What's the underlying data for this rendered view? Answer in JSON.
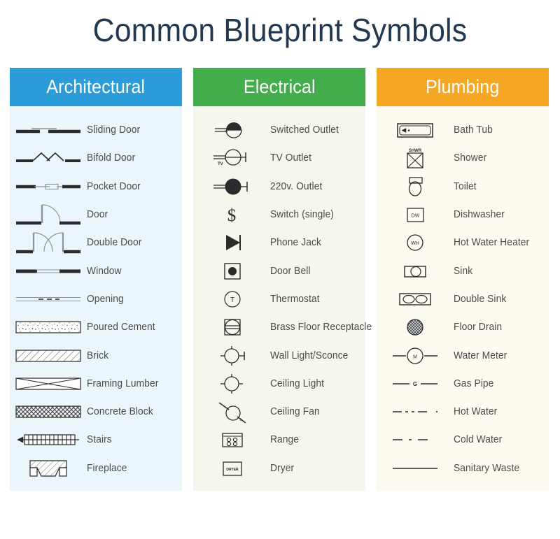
{
  "title": "Common Blueprint Symbols",
  "colors": {
    "architectural": "#2b9cd8",
    "electrical": "#43ad4c",
    "plumbing": "#f5a623",
    "title_text": "#22384f",
    "label_text": "#4a4a4a",
    "symbol_ink": "#2b2b2b"
  },
  "columns": [
    {
      "id": "architectural",
      "header": "Architectural",
      "items": [
        {
          "symbol": "sliding-door-symbol",
          "label": "Sliding Door"
        },
        {
          "symbol": "bifold-door-symbol",
          "label": "Bifold Door"
        },
        {
          "symbol": "pocket-door-symbol",
          "label": "Pocket Door"
        },
        {
          "symbol": "door-symbol",
          "label": "Door"
        },
        {
          "symbol": "double-door-symbol",
          "label": "Double Door"
        },
        {
          "symbol": "window-symbol",
          "label": "Window"
        },
        {
          "symbol": "opening-symbol",
          "label": "Opening"
        },
        {
          "symbol": "poured-cement-symbol",
          "label": "Poured Cement"
        },
        {
          "symbol": "brick-symbol",
          "label": "Brick"
        },
        {
          "symbol": "framing-lumber-symbol",
          "label": "Framing Lumber"
        },
        {
          "symbol": "concrete-block-symbol",
          "label": "Concrete Block"
        },
        {
          "symbol": "stairs-symbol",
          "label": "Stairs"
        },
        {
          "symbol": "fireplace-symbol",
          "label": "Fireplace"
        }
      ]
    },
    {
      "id": "electrical",
      "header": "Electrical",
      "items": [
        {
          "symbol": "switched-outlet-symbol",
          "label": "Switched Outlet"
        },
        {
          "symbol": "tv-outlet-symbol",
          "label": "TV Outlet",
          "glyph": "TV"
        },
        {
          "symbol": "220v-outlet-symbol",
          "label": "220v. Outlet"
        },
        {
          "symbol": "switch-single-symbol",
          "label": "Switch (single)",
          "glyph": "$"
        },
        {
          "symbol": "phone-jack-symbol",
          "label": "Phone Jack"
        },
        {
          "symbol": "door-bell-symbol",
          "label": "Door Bell"
        },
        {
          "symbol": "thermostat-symbol",
          "label": "Thermostat",
          "glyph": "T"
        },
        {
          "symbol": "brass-floor-receptacle-symbol",
          "label": "Brass Floor Receptacle"
        },
        {
          "symbol": "wall-light-sconce-symbol",
          "label": "Wall Light/Sconce"
        },
        {
          "symbol": "ceiling-light-symbol",
          "label": "Ceiling Light"
        },
        {
          "symbol": "ceiling-fan-symbol",
          "label": "Ceiling Fan"
        },
        {
          "symbol": "range-symbol",
          "label": "Range"
        },
        {
          "symbol": "dryer-symbol",
          "label": "Dryer",
          "glyph": "DRYER"
        }
      ]
    },
    {
      "id": "plumbing",
      "header": "Plumbing",
      "items": [
        {
          "symbol": "bath-tub-symbol",
          "label": "Bath Tub"
        },
        {
          "symbol": "shower-symbol",
          "label": "Shower",
          "glyph": "SHWR"
        },
        {
          "symbol": "toilet-symbol",
          "label": "Toilet"
        },
        {
          "symbol": "dishwasher-symbol",
          "label": "Dishwasher",
          "glyph": "DW"
        },
        {
          "symbol": "hot-water-heater-symbol",
          "label": "Hot Water Heater",
          "glyph": "WH"
        },
        {
          "symbol": "sink-symbol",
          "label": "Sink"
        },
        {
          "symbol": "double-sink-symbol",
          "label": "Double Sink"
        },
        {
          "symbol": "floor-drain-symbol",
          "label": "Floor Drain"
        },
        {
          "symbol": "water-meter-symbol",
          "label": "Water Meter",
          "glyph": "M"
        },
        {
          "symbol": "gas-pipe-symbol",
          "label": "Gas Pipe",
          "glyph": "G"
        },
        {
          "symbol": "hot-water-symbol",
          "label": "Hot Water"
        },
        {
          "symbol": "cold-water-symbol",
          "label": "Cold Water"
        },
        {
          "symbol": "sanitary-waste-symbol",
          "label": "Sanitary Waste"
        }
      ]
    }
  ]
}
